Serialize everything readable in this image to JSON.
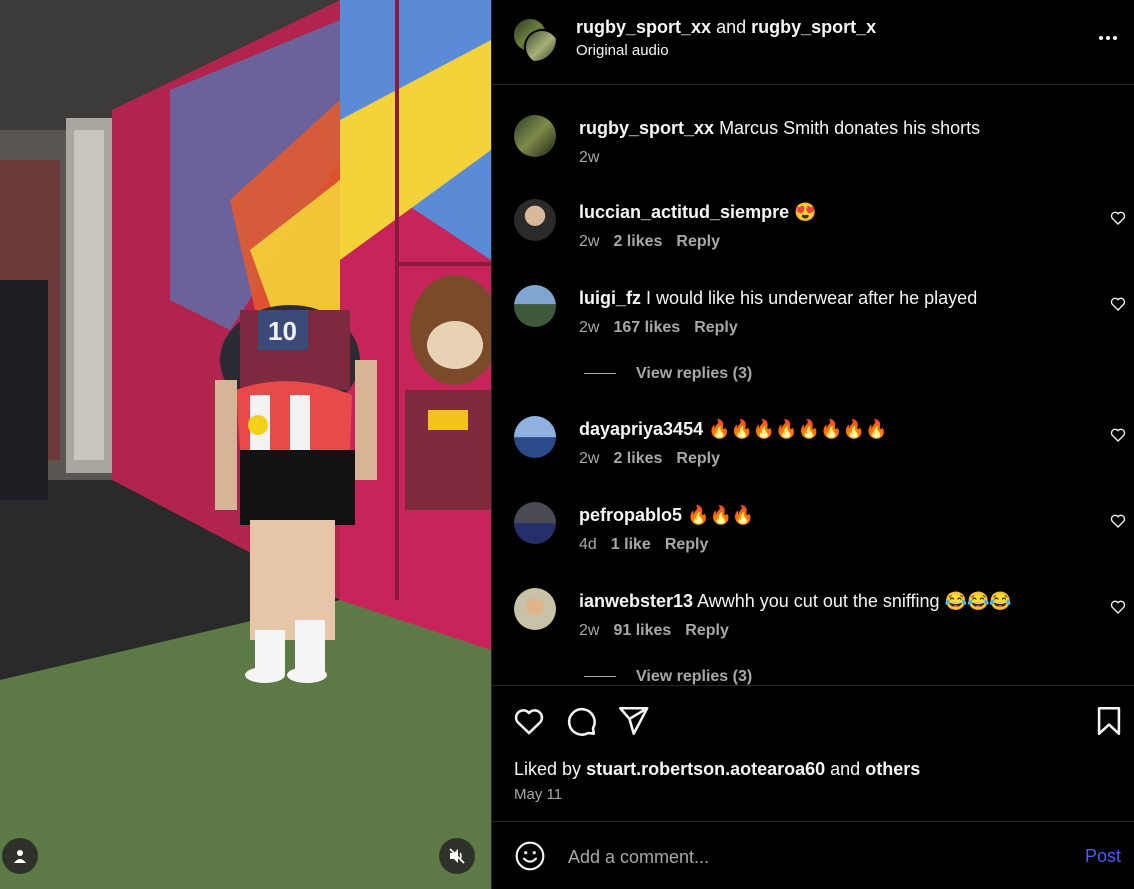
{
  "header": {
    "user1": "rugby_sport_xx",
    "connector": "and",
    "user2": "rugby_sport_x",
    "subtitle": "Original audio",
    "more_icon": "more-horizontal-icon"
  },
  "caption": {
    "username": "rugby_sport_xx",
    "text": "Marcus Smith donates his shorts",
    "time": "2w"
  },
  "comments": [
    {
      "username": "luccian_actitud_siempre",
      "text": "😍",
      "time": "2w",
      "likes": "2 likes",
      "reply": "Reply"
    },
    {
      "username": "luigi_fz",
      "text": "I would like his underwear after he played",
      "time": "2w",
      "likes": "167 likes",
      "reply": "Reply",
      "view_replies": "View replies (3)"
    },
    {
      "username": "dayapriya3454",
      "text": "🔥🔥🔥🔥🔥🔥🔥🔥",
      "time": "2w",
      "likes": "2 likes",
      "reply": "Reply"
    },
    {
      "username": "pefropablo5",
      "text": "🔥🔥🔥",
      "time": "4d",
      "likes": "1 like",
      "reply": "Reply"
    },
    {
      "username": "ianwebster13",
      "text": "Awwhh you cut out the sniffing 😂😂😂",
      "time": "2w",
      "likes": "91 likes",
      "reply": "Reply",
      "view_replies": "View replies (3)"
    }
  ],
  "actions": {
    "liked_prefix": "Liked by",
    "liked_user": "stuart.robertson.aotearoa60",
    "liked_and": "and",
    "liked_others": "others",
    "date": "May 11"
  },
  "add_comment": {
    "placeholder": "Add a comment...",
    "post_label": "Post"
  },
  "colors": {
    "background": "#000000",
    "secondary_text": "#a8a8a8",
    "post_button": "#4a5df9",
    "divider": "#262626"
  }
}
